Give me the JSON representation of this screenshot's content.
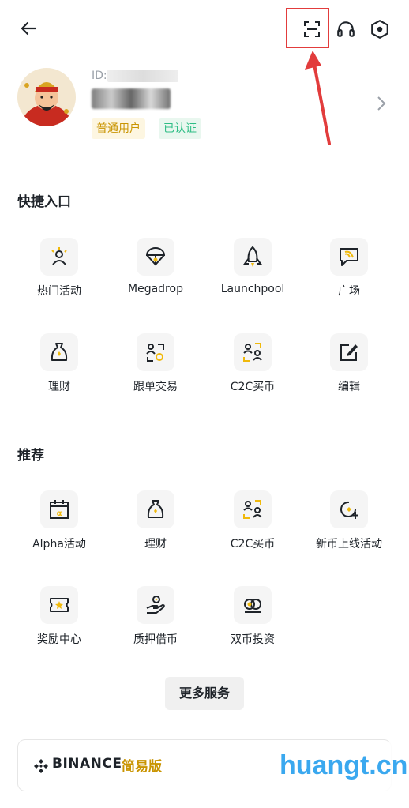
{
  "header": {
    "back_icon": "arrow-left-icon",
    "scan_icon": "scan-icon",
    "support_icon": "headset-icon",
    "settings_icon": "hexagon-gear-icon",
    "highlight_color": "#e23c3c"
  },
  "profile": {
    "id_label": "ID:",
    "badge_user": "普通用户",
    "badge_verified": "已认证"
  },
  "quick_entry": {
    "title": "快捷入口",
    "items": [
      {
        "label": "热门活动",
        "icon": "person-sparkle-icon"
      },
      {
        "label": "Megadrop",
        "icon": "parachute-icon"
      },
      {
        "label": "Launchpool",
        "icon": "rocket-icon"
      },
      {
        "label": "广场",
        "icon": "chat-square-icon"
      },
      {
        "label": "理财",
        "icon": "money-bag-icon"
      },
      {
        "label": "跟单交易",
        "icon": "copy-trade-icon"
      },
      {
        "label": "C2C买币",
        "icon": "c2c-users-icon"
      },
      {
        "label": "编辑",
        "icon": "edit-icon"
      }
    ]
  },
  "recommend": {
    "title": "推荐",
    "items": [
      {
        "label": "Alpha活动",
        "icon": "alpha-calendar-icon"
      },
      {
        "label": "理财",
        "icon": "money-bag-icon"
      },
      {
        "label": "C2C买币",
        "icon": "c2c-users-icon"
      },
      {
        "label": "新币上线活动",
        "icon": "new-coin-icon"
      },
      {
        "label": "奖励中心",
        "icon": "ticket-star-icon"
      },
      {
        "label": "质押借币",
        "icon": "hand-coin-icon"
      },
      {
        "label": "双币投资",
        "icon": "dual-coin-icon"
      }
    ]
  },
  "more_services": "更多服务",
  "footer_card": {
    "brand": "BINANCE",
    "subtitle": "简易版"
  },
  "watermark": "huangt.cn",
  "colors": {
    "accent": "#f0b90b",
    "text": "#1e2329",
    "green": "#2ebd85"
  }
}
